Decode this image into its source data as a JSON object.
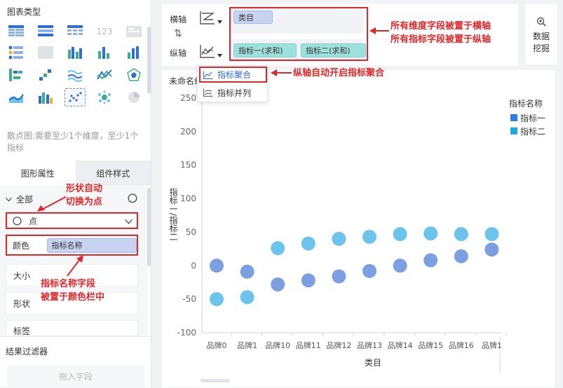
{
  "left_panel": {
    "chart_type_title": "图表类型",
    "chart_type_desc": "散点图:需要至少1个维度，至少1个指标",
    "tabs": [
      {
        "label": "图形属性"
      },
      {
        "label": "组件样式"
      }
    ],
    "all_label": "全部",
    "shape_select_value": "点",
    "color_label": "颜色",
    "color_field": "指标名称",
    "size_label": "大小",
    "shape_label": "形状",
    "tag_label": "标签",
    "result_filter_title": "结果过滤器",
    "drop_field_placeholder": "拖入字段"
  },
  "axis_panel": {
    "x_label": "横轴",
    "y_label": "纵轴",
    "x_fields": [
      "类目"
    ],
    "y_fields": [
      "指标一(求和)",
      "指标二(求和)"
    ],
    "dropdown_items": [
      "指标聚合",
      "指标并列"
    ]
  },
  "mining": {
    "label_1": "数据",
    "label_2": "挖掘"
  },
  "annotations": {
    "top_right_1": "所有维度字段被置于横轴",
    "top_right_2": "所有指标字段被置于纵轴",
    "aggregation_note": "纵轴自动开启指标聚合",
    "shape_note_1": "形状自动",
    "shape_note_2": "切换为点",
    "color_note_1": "指标名称字段",
    "color_note_2": "被置于颜色栏中"
  },
  "canvas": {
    "widget_title": "未命名组"
  },
  "colors": {
    "series1": "#7b9fe0",
    "series2": "#6cc3ec",
    "accent_red": "#e3262a"
  },
  "chart_data": {
    "type": "scatter",
    "categories": [
      "品牌0",
      "品牌1",
      "品牌10",
      "品牌11",
      "品牌12",
      "品牌13",
      "品牌14",
      "品牌15",
      "品牌16",
      "品牌1"
    ],
    "series": [
      {
        "name": "指标一",
        "values": [
          0,
          -9,
          -28,
          -22,
          -16,
          -8,
          0,
          8,
          14,
          24
        ]
      },
      {
        "name": "指标二",
        "values": [
          -50,
          -47,
          26,
          33,
          40,
          43,
          47,
          48,
          47,
          47
        ]
      }
    ],
    "xlabel": "类目",
    "ylabel": "指标一/指标二",
    "ylim": [
      -100,
      250
    ],
    "yticks": [
      250,
      200,
      150,
      100,
      50,
      0,
      -50,
      -100
    ],
    "legend_title": "指标名称",
    "legend_position": "right"
  }
}
